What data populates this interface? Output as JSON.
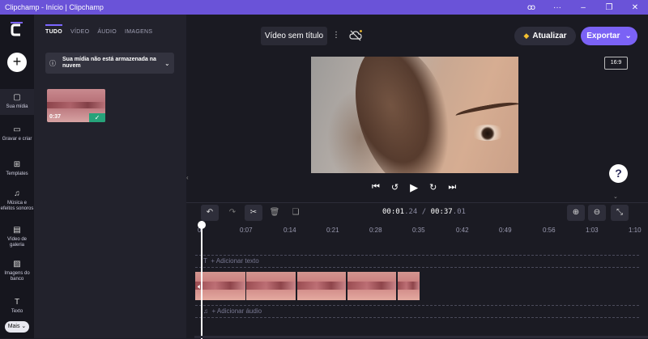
{
  "window": {
    "title": "Clipchamp - Início | Clipchamp",
    "controls": [
      "settings-icon",
      "more-icon",
      "minimize-icon",
      "maximize-icon",
      "close-icon"
    ],
    "controls_glyphs": [
      "ꝏ",
      "···",
      "–",
      "❐",
      "✕"
    ]
  },
  "rail": {
    "items": [
      {
        "label": "Sua mídia",
        "icon": "▢"
      },
      {
        "label": "Gravar e criar",
        "icon": "▭"
      },
      {
        "label": "Templates",
        "icon": "⊞"
      },
      {
        "label": "Música e efeitos sonoros",
        "icon": "♫"
      },
      {
        "label": "Vídeo de galeria",
        "icon": "▤"
      },
      {
        "label": "Imagens do banco",
        "icon": "▨"
      },
      {
        "label": "Texto",
        "icon": "T"
      }
    ],
    "more_label": "Mais ⌄",
    "add_label": "+"
  },
  "media": {
    "tabs": [
      "TUDO",
      "VÍDEO",
      "ÁUDIO",
      "IMAGENS"
    ],
    "notice": "Sua mídia não está armazenada na nuvem",
    "item_duration": "0:37"
  },
  "preview": {
    "project_title": "Vídeo sem título",
    "upgrade_label": "Atualizar",
    "export_label": "Exportar",
    "aspect_ratio": "16:9",
    "help_label": "?"
  },
  "timeline": {
    "time_current_a": "00:01",
    "time_current_b": ".24",
    "time_sep": " / ",
    "time_total_a": "00:37",
    "time_total_b": ".01",
    "ticks": [
      "0",
      "0:07",
      "0:14",
      "0:21",
      "0:28",
      "0:35",
      "0:42",
      "0:49",
      "0:56",
      "1:03",
      "1:10"
    ],
    "add_text_label": "+ Adicionar texto",
    "add_audio_label": "+ Adicionar áudio"
  },
  "colors": {
    "accent": "#7b62f5",
    "titlebar": "#6a53d8",
    "check": "#26a37a"
  }
}
